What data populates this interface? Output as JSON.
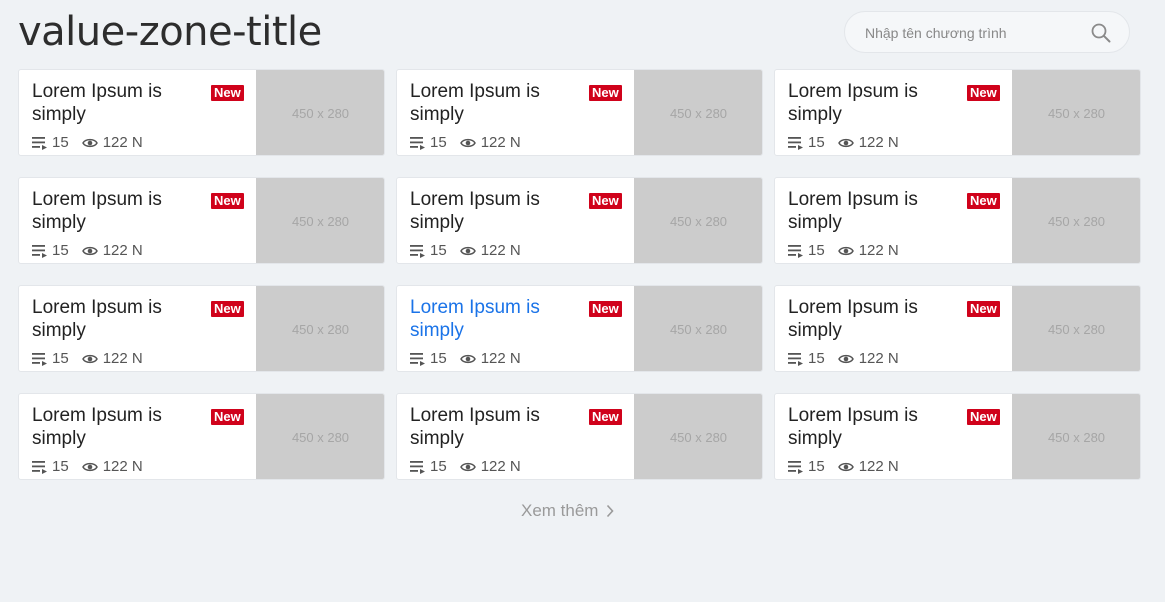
{
  "page": {
    "title": "value-zone-title"
  },
  "search": {
    "placeholder": "Nhập tên chương trình",
    "icon": "search-icon"
  },
  "cards": [
    {
      "title": "Lorem Ipsum is simply",
      "badge": "New",
      "episodes": "15",
      "views": "122 N",
      "thumb_label": "450 x 280",
      "active": false
    },
    {
      "title": "Lorem Ipsum is simply",
      "badge": "New",
      "episodes": "15",
      "views": "122 N",
      "thumb_label": "450 x 280",
      "active": false
    },
    {
      "title": "Lorem Ipsum is simply",
      "badge": "New",
      "episodes": "15",
      "views": "122 N",
      "thumb_label": "450 x 280",
      "active": false
    },
    {
      "title": "Lorem Ipsum is simply",
      "badge": "New",
      "episodes": "15",
      "views": "122 N",
      "thumb_label": "450 x 280",
      "active": false
    },
    {
      "title": "Lorem Ipsum is simply",
      "badge": "New",
      "episodes": "15",
      "views": "122 N",
      "thumb_label": "450 x 280",
      "active": false
    },
    {
      "title": "Lorem Ipsum is simply",
      "badge": "New",
      "episodes": "15",
      "views": "122 N",
      "thumb_label": "450 x 280",
      "active": false
    },
    {
      "title": "Lorem Ipsum is simply",
      "badge": "New",
      "episodes": "15",
      "views": "122 N",
      "thumb_label": "450 x 280",
      "active": false
    },
    {
      "title": "Lorem Ipsum is simply",
      "badge": "New",
      "episodes": "15",
      "views": "122 N",
      "thumb_label": "450 x 280",
      "active": true
    },
    {
      "title": "Lorem Ipsum is simply",
      "badge": "New",
      "episodes": "15",
      "views": "122 N",
      "thumb_label": "450 x 280",
      "active": false
    },
    {
      "title": "Lorem Ipsum is simply",
      "badge": "New",
      "episodes": "15",
      "views": "122 N",
      "thumb_label": "450 x 280",
      "active": false
    },
    {
      "title": "Lorem Ipsum is simply",
      "badge": "New",
      "episodes": "15",
      "views": "122 N",
      "thumb_label": "450 x 280",
      "active": false
    },
    {
      "title": "Lorem Ipsum is simply",
      "badge": "New",
      "episodes": "15",
      "views": "122 N",
      "thumb_label": "450 x 280",
      "active": false
    }
  ],
  "more": {
    "label": "Xem thêm"
  },
  "colors": {
    "background": "#eff2f5",
    "badge": "#d0021b",
    "link_active": "#1a73e8",
    "placeholder_image": "#cccccc"
  }
}
